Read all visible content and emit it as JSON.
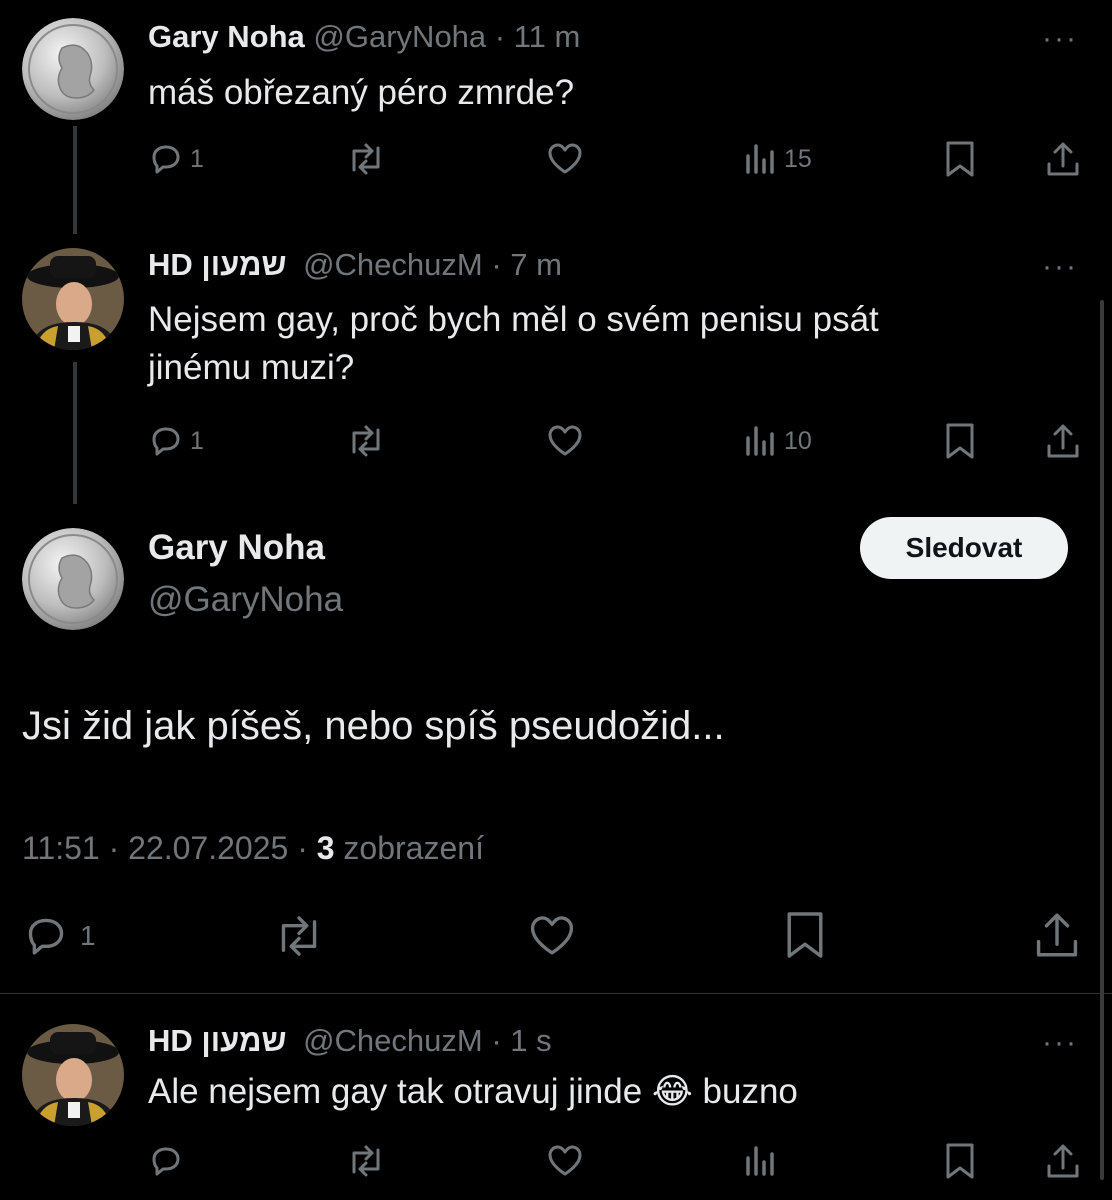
{
  "tweets": [
    {
      "display_name": "Gary Noha",
      "handle": "@GaryNoha",
      "time": "· 11 m",
      "text": "máš obřezaný péro zmrde?",
      "reply_count": "1",
      "view_count": "15",
      "avatar_icon": "silver-coin-avatar"
    },
    {
      "display_name": "HD שמעון",
      "handle": "@ChechuzM",
      "time": "· 7 m",
      "text_line1": "Nejsem gay, proč bych měl o svém penisu psát",
      "text_line2": "jinému muzi?",
      "reply_count": "1",
      "view_count": "10",
      "avatar_icon": "man-portrait-avatar"
    }
  ],
  "focused": {
    "display_name": "Gary Noha",
    "handle": "@GaryNoha",
    "follow_label": "Sledovat",
    "text": "Jsi žid jak píšeš, nebo spíš pseudožid...",
    "timestamp": "11:51 · 22.07.2025 ·",
    "views_number": "3",
    "views_label": "zobrazení",
    "reply_count": "1"
  },
  "reply": {
    "display_name": "HD שמעון",
    "handle": "@ChechuzM",
    "time": "· 1 s",
    "text_before": "Ale nejsem gay tak otravuj jinde",
    "emoji": "😂",
    "text_after": "buzno"
  },
  "more_label": "···",
  "colors": {
    "background": "#000000",
    "text": "#e7e9ea",
    "muted": "#71767b",
    "button_bg": "#eff3f4"
  }
}
